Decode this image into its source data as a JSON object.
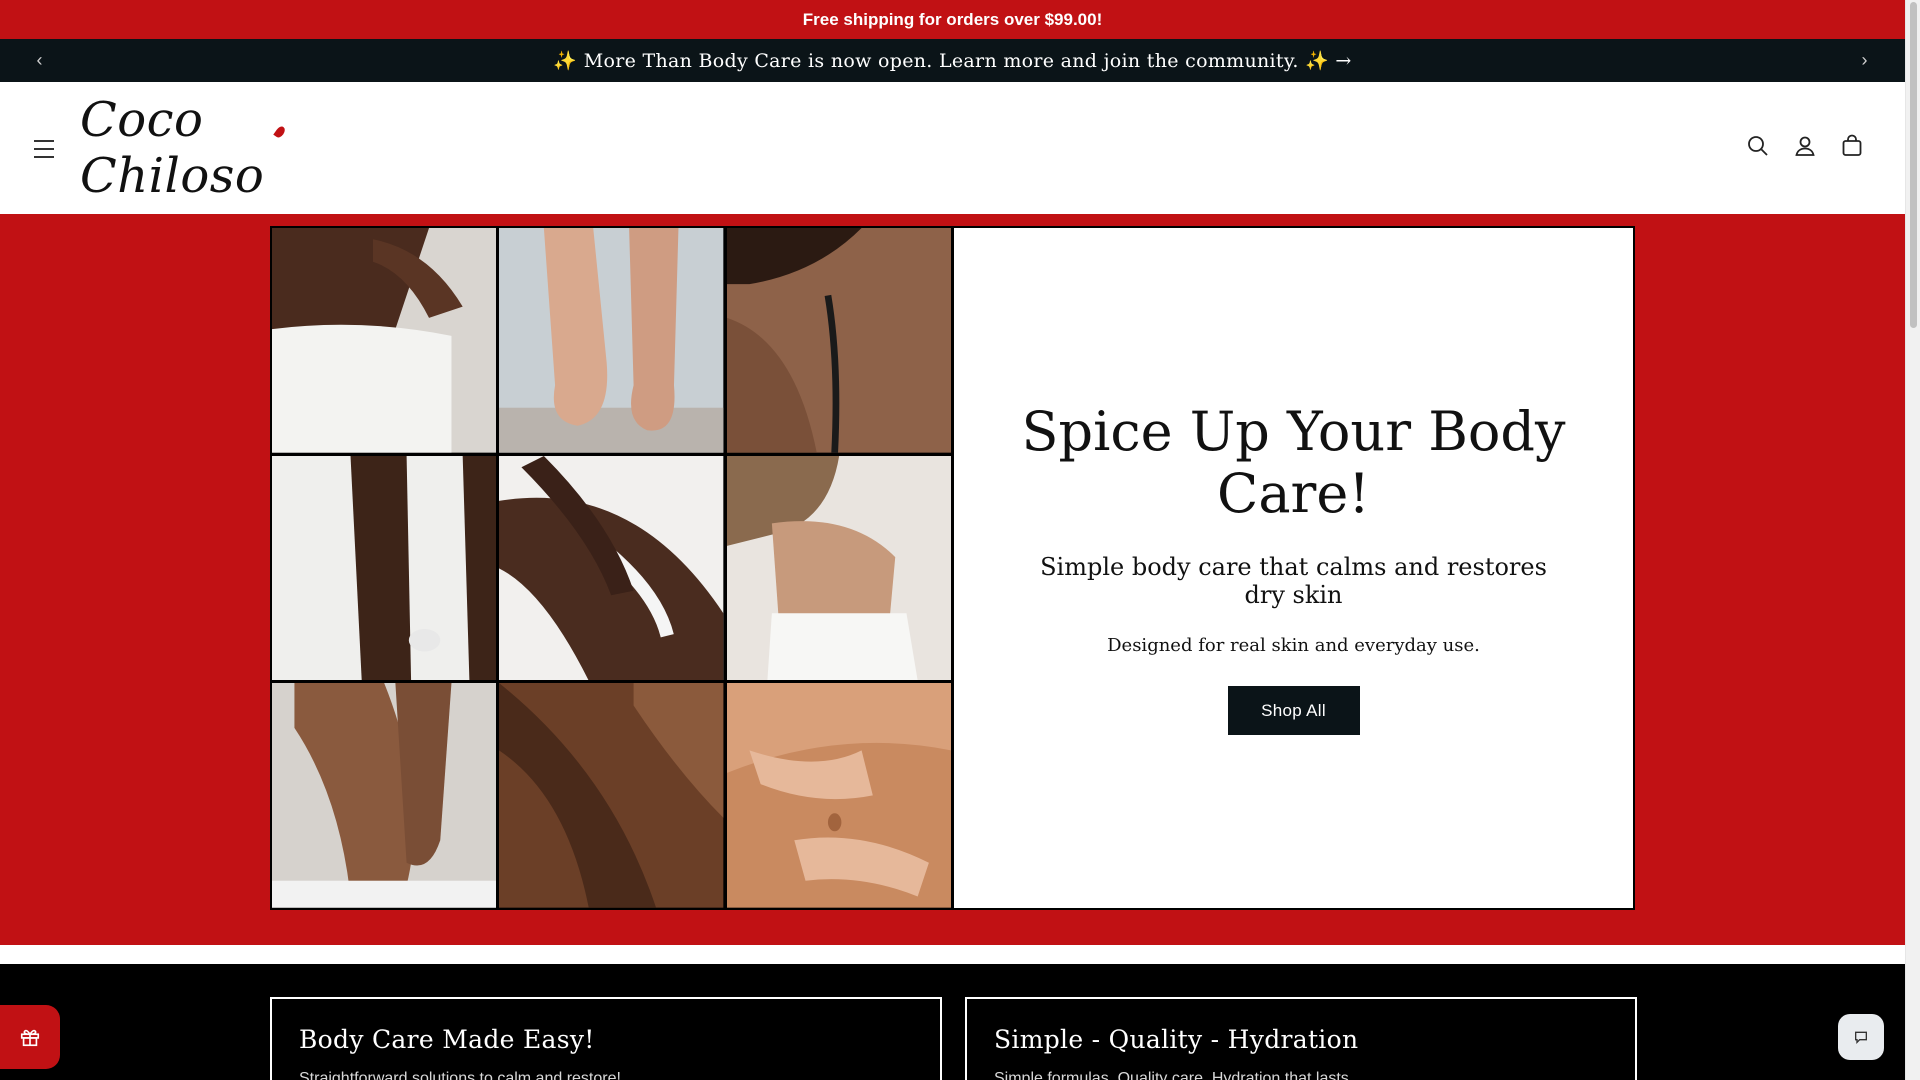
{
  "shipping_bar": {
    "text": "Free shipping for orders over $99.00!"
  },
  "announcement": {
    "text": "✨ More Than Body Care is now open. Learn more and join the community. ✨ →",
    "prev_icon": "chevron-left-icon",
    "next_icon": "chevron-right-icon"
  },
  "header": {
    "logo_text": "Coco Chiloso",
    "icons": [
      "menu-icon",
      "search-icon",
      "account-icon",
      "cart-icon"
    ]
  },
  "hero": {
    "title": "Spice Up Your Body Care!",
    "subtitle": "Simple body care that calms and restores dry skin",
    "description": "Designed for real skin and everyday use.",
    "button_label": "Shop All",
    "image_tiles": 9
  },
  "features": [
    {
      "title": "Body Care Made Easy!",
      "text": "Straightforward solutions to calm and restore!"
    },
    {
      "title": "Simple - Quality - Hydration",
      "text": "Simple formulas. Quality care. Hydration that lasts."
    }
  ],
  "colors": {
    "brand_red": "#c11114",
    "dark": "#0b1418",
    "white": "#ffffff"
  }
}
